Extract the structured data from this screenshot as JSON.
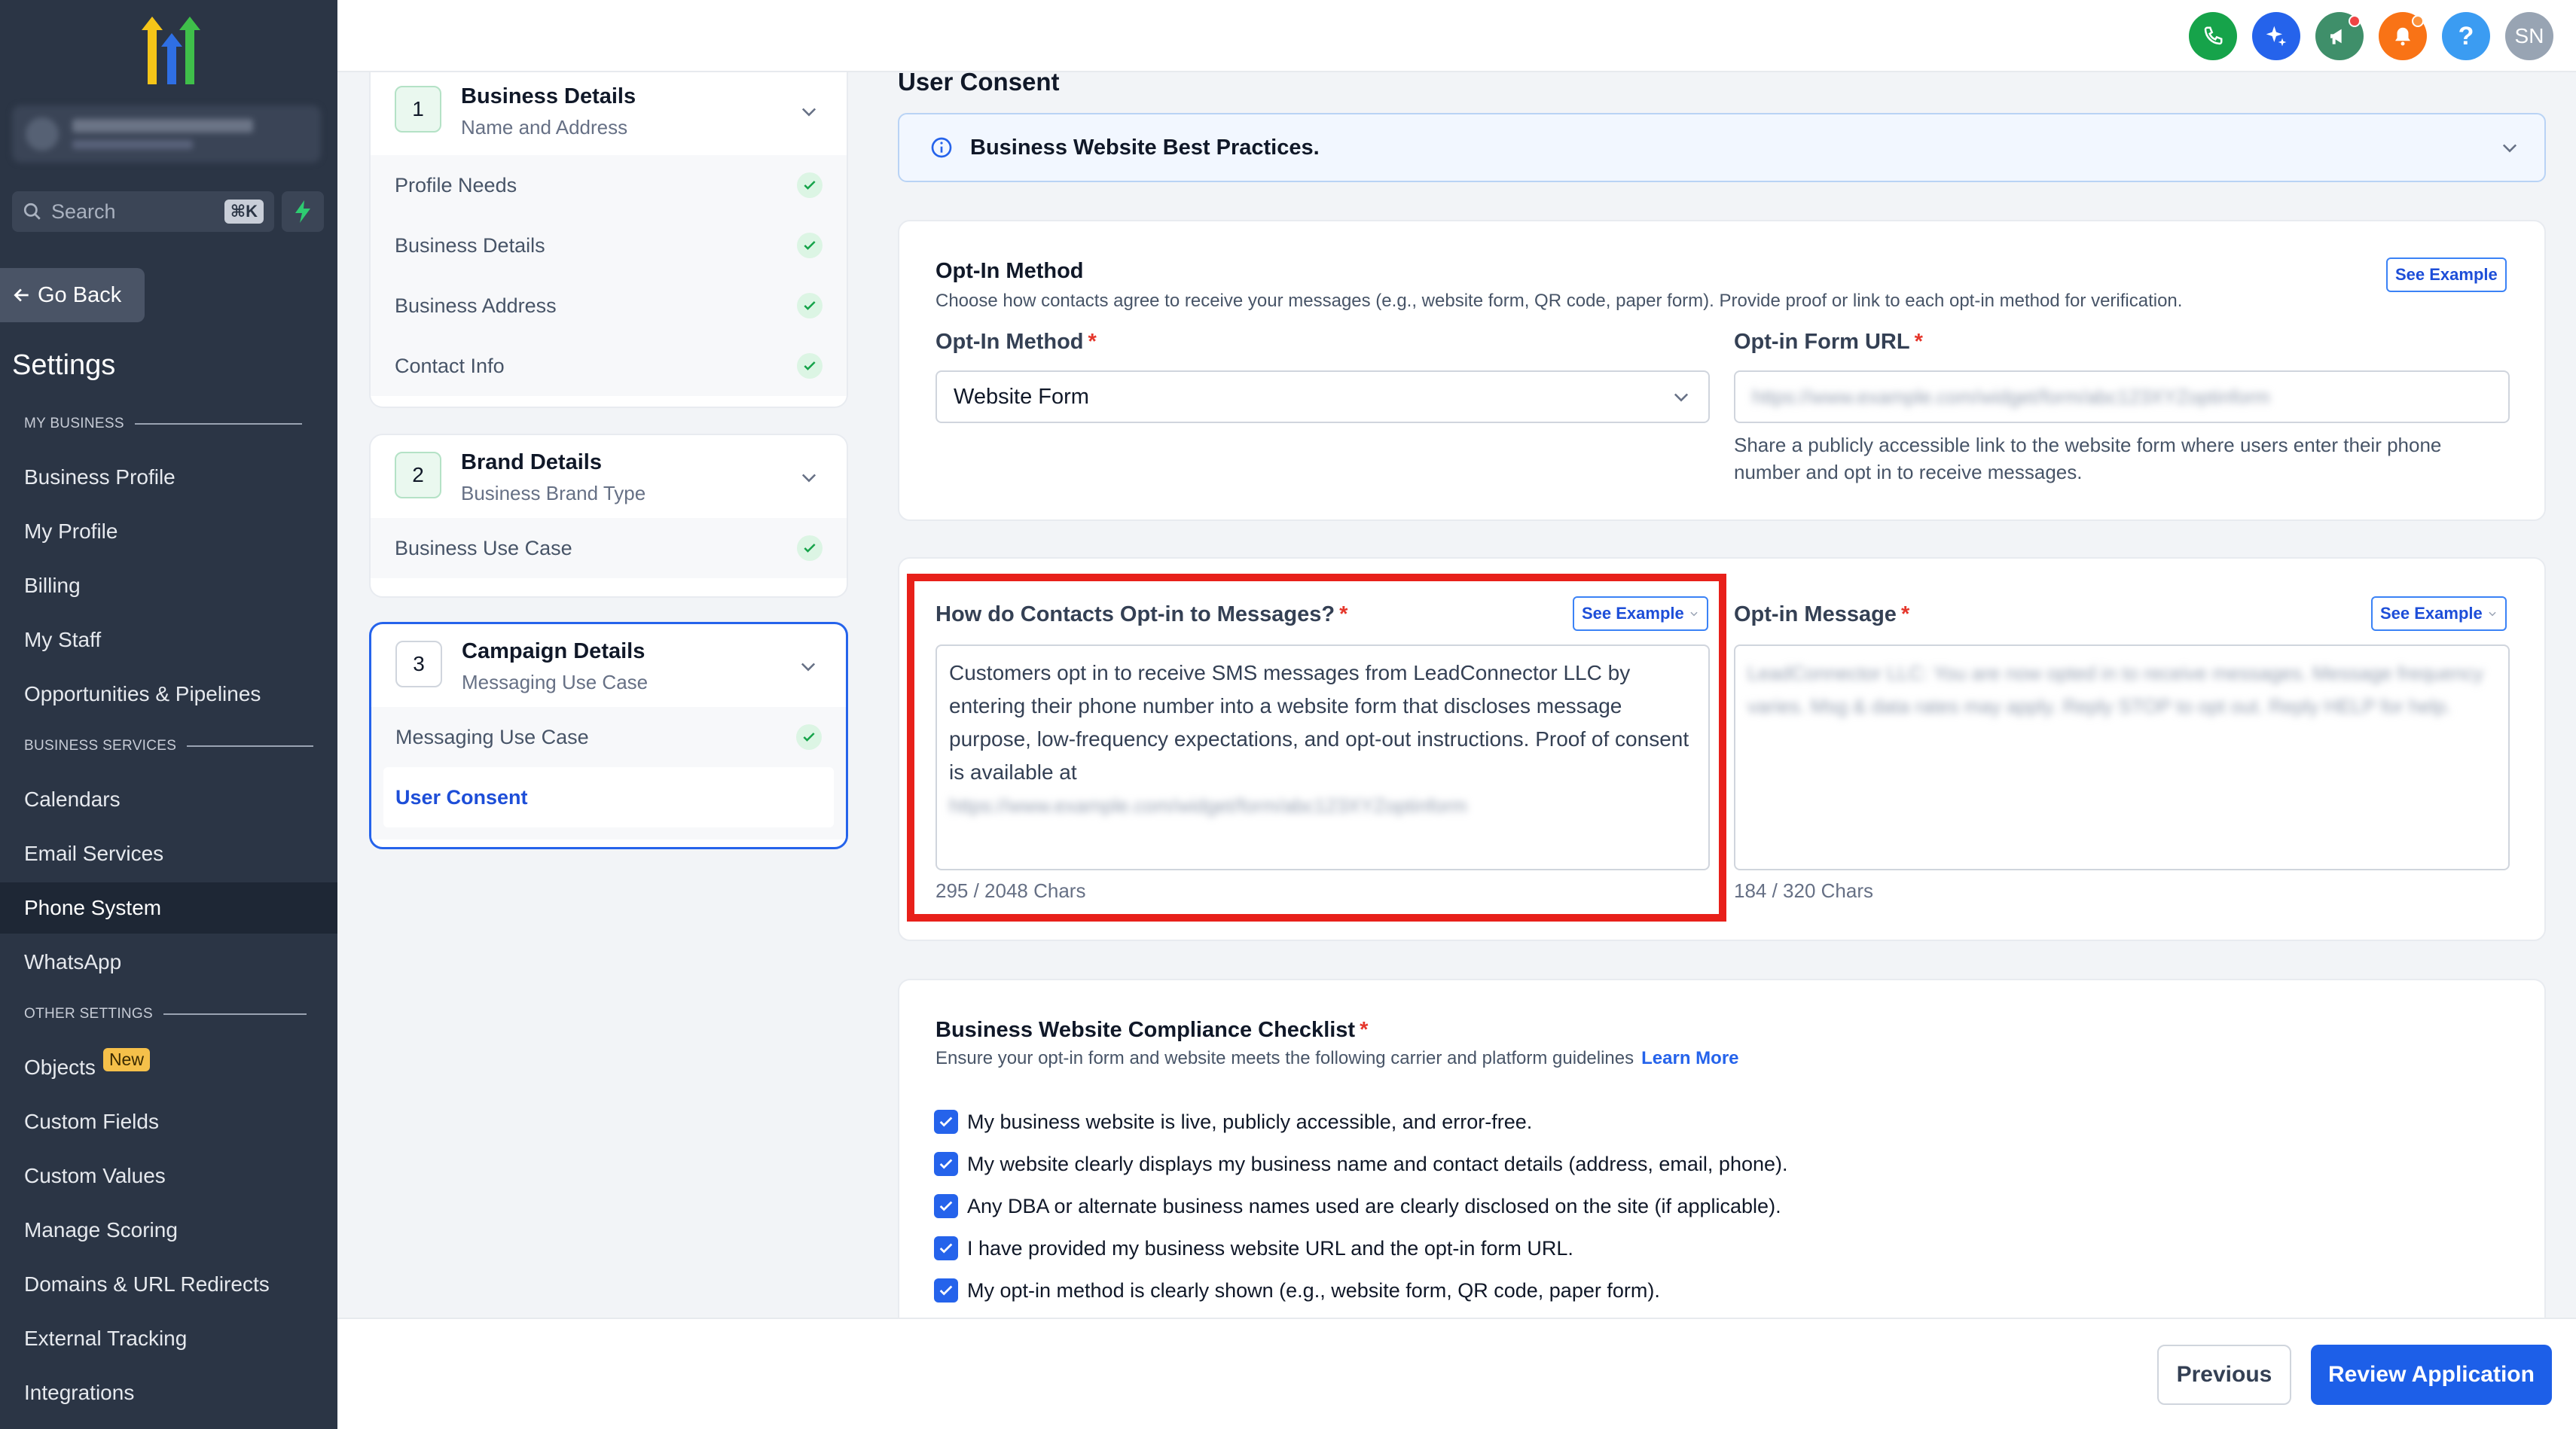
{
  "sidebar": {
    "search_placeholder": "Search",
    "search_shortcut": "⌘K",
    "go_back": "Go Back",
    "settings_title": "Settings",
    "sections": {
      "my_business": "MY BUSINESS",
      "business_services": "BUSINESS SERVICES",
      "other_settings": "OTHER SETTINGS"
    },
    "items": [
      "Business Profile",
      "My Profile",
      "Billing",
      "My Staff",
      "Opportunities & Pipelines",
      "Calendars",
      "Email Services",
      "Phone System",
      "WhatsApp",
      "Objects",
      "Custom Fields",
      "Custom Values",
      "Manage Scoring",
      "Domains & URL Redirects",
      "External Tracking",
      "Integrations"
    ],
    "active_item": "Phone System",
    "objects_badge": "New"
  },
  "topbar": {
    "avatar_initials": "SN",
    "icons": [
      "phone-icon",
      "sparkle-icon",
      "megaphone-icon",
      "bell-icon",
      "help-icon"
    ],
    "colors": {
      "phone": "#16a34a",
      "sparkle": "#2563eb",
      "megaphone": "#3f8f6a",
      "bell": "#f97316",
      "help": "#3b9cf2",
      "avatar": "#98a4b3"
    }
  },
  "stepper": {
    "steps": [
      {
        "number": "1",
        "title": "Business Details",
        "subtitle": "Name and Address",
        "items": [
          "Profile Needs",
          "Business Details",
          "Business Address",
          "Contact Info"
        ]
      },
      {
        "number": "2",
        "title": "Brand Details",
        "subtitle": "Business Brand Type",
        "items": [
          "Business Use Case"
        ]
      },
      {
        "number": "3",
        "title": "Campaign Details",
        "subtitle": "Messaging Use Case",
        "items": [
          "Messaging Use Case",
          "User Consent"
        ]
      }
    ]
  },
  "main": {
    "title": "User Consent",
    "banner": "Business Website Best Practices.",
    "optin_card": {
      "heading": "Opt-In Method",
      "description": "Choose how contacts agree to receive your messages (e.g., website form, QR code, paper form). Provide proof or link to each opt-in method for verification.",
      "see_example": "See Example",
      "method_label": "Opt-In Method",
      "method_value": "Website Form",
      "url_label": "Opt-in Form URL",
      "url_value": "https://www.example.com/widget/form/abc123XYZoptinform",
      "url_help_1": "Share a publicly accessible link to the website form where users enter their phone",
      "url_help_2": "number and opt in to receive messages."
    },
    "messages_card": {
      "contacts_label": "How do Contacts Opt-in to Messages?",
      "contacts_see_example": "See Example",
      "contacts_text": "Customers opt in to receive SMS messages from LeadConnector LLC by entering their phone number into a website form that discloses message purpose, low-frequency expectations, and opt-out instructions. Proof of consent is available at",
      "contacts_text_link": "https://www.example.com/widget/form/abc123XYZoptinform",
      "contacts_chars": "295 / 2048 Chars",
      "message_label": "Opt-in Message",
      "message_see_example": "See Example",
      "message_text": "LeadConnector LLC: You are now opted in to receive messages. Message frequency varies. Msg & data rates may apply. Reply STOP to opt out. Reply HELP for help.",
      "message_chars": "184 / 320 Chars"
    },
    "checklist": {
      "heading": "Business Website Compliance Checklist",
      "description": "Ensure your opt-in form and website meets the following carrier and platform guidelines",
      "learn_more": "Learn More",
      "items": [
        "My business website is live, publicly accessible, and error-free.",
        "My website clearly displays my business name and contact details (address, email, phone).",
        "Any DBA or alternate business names used are clearly disclosed on the site (if applicable).",
        "I have provided my business website URL and the opt-in form URL.",
        "My opt-in method is clearly shown (e.g., website form, QR code, paper form)."
      ]
    }
  },
  "footer": {
    "previous": "Previous",
    "review": "Review Application"
  }
}
